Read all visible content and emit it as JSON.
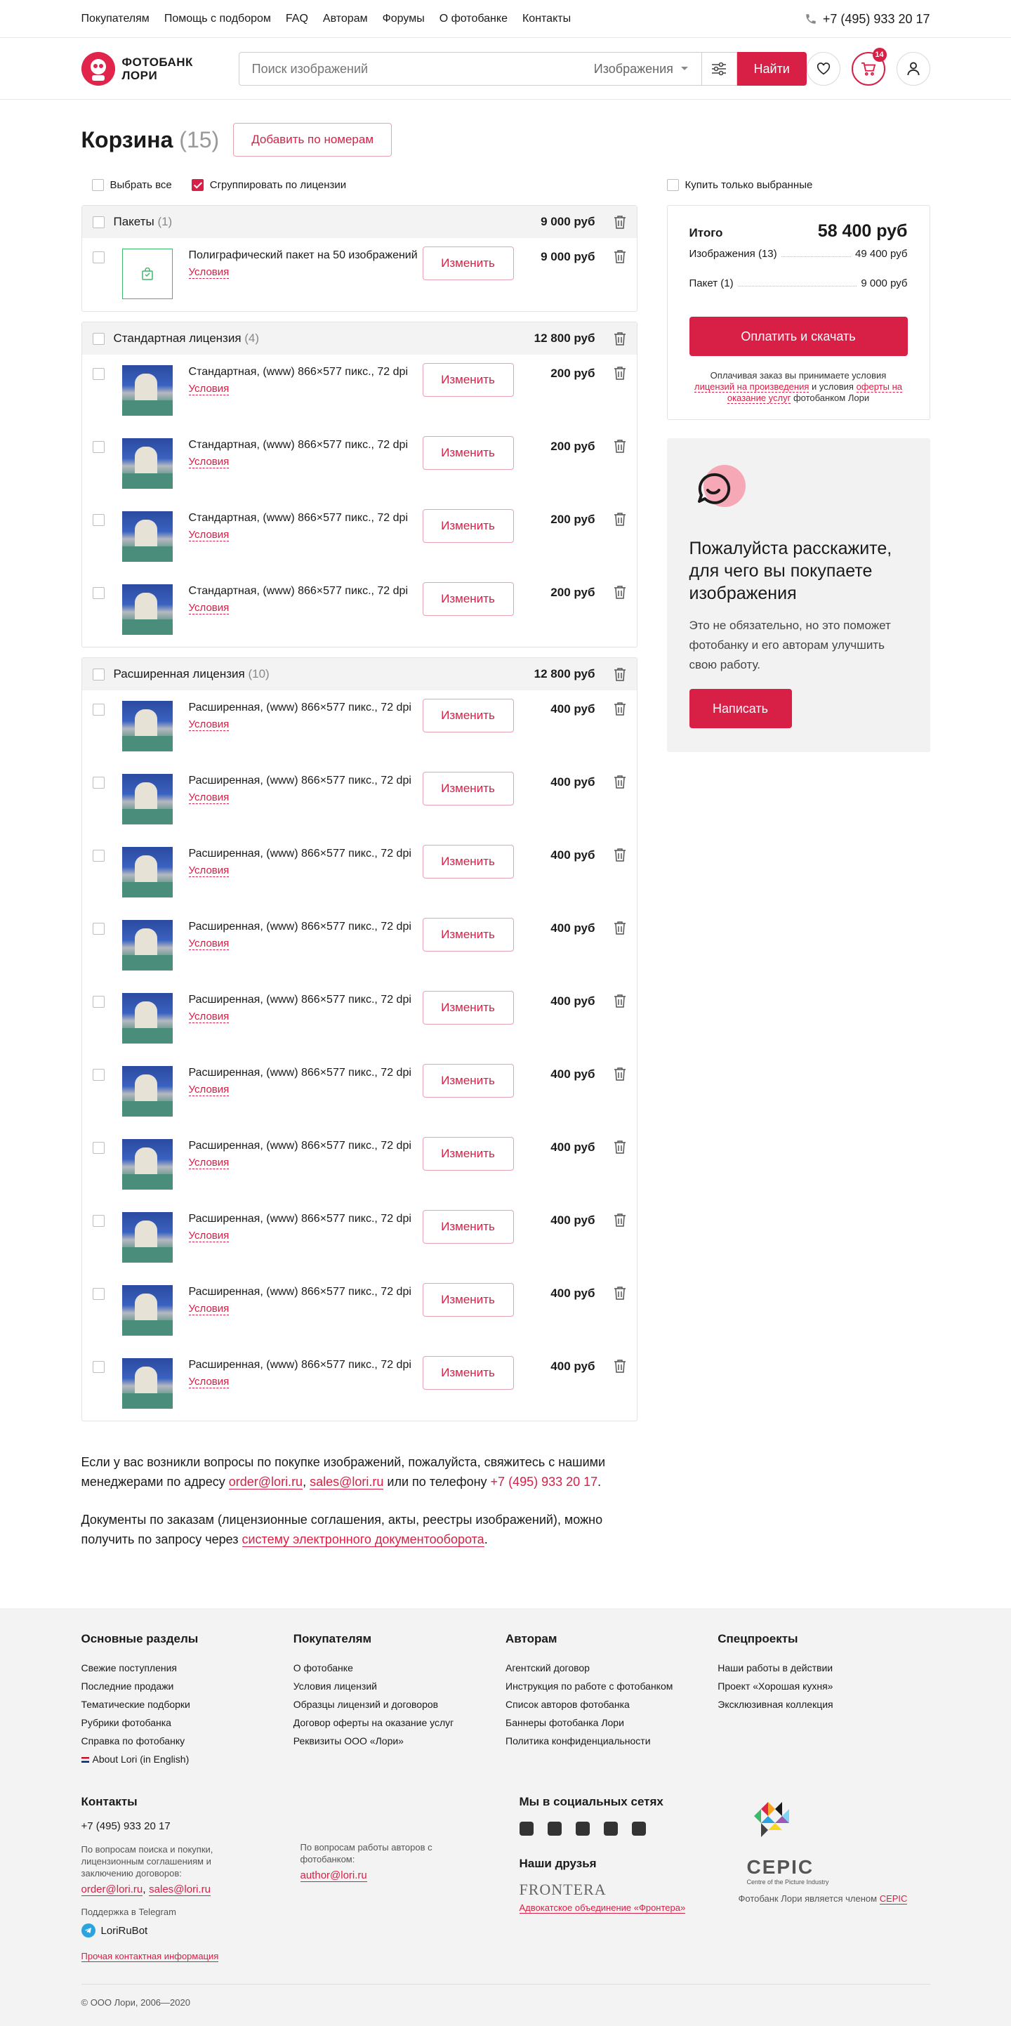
{
  "topbar": {
    "nav": [
      "Покупателям",
      "Помощь с подбором",
      "FAQ",
      "Авторам",
      "Форумы",
      "О фотобанке",
      "Контакты"
    ],
    "phone": "+7 (495) 933 20 17"
  },
  "header": {
    "logo_line1": "ФОТОБАНК",
    "logo_line2": "ЛОРИ",
    "search_placeholder": "Поиск изображений",
    "search_type": "Изображения",
    "find_label": "Найти",
    "cart_count": "14"
  },
  "page": {
    "title": "Корзина",
    "title_count": "(15)",
    "add_by_numbers": "Добавить по номерам",
    "select_all": "Выбрать все",
    "group_by_license": "Сгруппировать по лицензии",
    "buy_selected_only": "Купить только выбранные"
  },
  "groups": [
    {
      "name": "Пакеты",
      "count": "(1)",
      "sum": "9 000 руб",
      "items": [
        {
          "title": "Полиграфический пакет на 50 изображений",
          "terms": "Условия",
          "change": "Изменить",
          "price": "9 000 руб",
          "kind": "package"
        }
      ]
    },
    {
      "name": "Стандартная лицензия",
      "count": "(4)",
      "sum": "12 800 руб",
      "items": [
        {
          "title": "Стандартная, (www) 866×577 пикс., 72 dpi",
          "terms": "Условия",
          "change": "Изменить",
          "price": "200 руб"
        },
        {
          "title": "Стандартная, (www) 866×577 пикс., 72 dpi",
          "terms": "Условия",
          "change": "Изменить",
          "price": "200 руб"
        },
        {
          "title": "Стандартная, (www) 866×577 пикс., 72 dpi",
          "terms": "Условия",
          "change": "Изменить",
          "price": "200 руб"
        },
        {
          "title": "Стандартная, (www) 866×577 пикс., 72 dpi",
          "terms": "Условия",
          "change": "Изменить",
          "price": "200 руб"
        }
      ]
    },
    {
      "name": "Расширенная лицензия",
      "count": "(10)",
      "sum": "12 800 руб",
      "items": [
        {
          "title": "Расширенная, (www) 866×577 пикс., 72 dpi",
          "terms": "Условия",
          "change": "Изменить",
          "price": "400 руб"
        },
        {
          "title": "Расширенная, (www) 866×577 пикс., 72 dpi",
          "terms": "Условия",
          "change": "Изменить",
          "price": "400 руб"
        },
        {
          "title": "Расширенная, (www) 866×577 пикс., 72 dpi",
          "terms": "Условия",
          "change": "Изменить",
          "price": "400 руб"
        },
        {
          "title": "Расширенная, (www) 866×577 пикс., 72 dpi",
          "terms": "Условия",
          "change": "Изменить",
          "price": "400 руб"
        },
        {
          "title": "Расширенная, (www) 866×577 пикс., 72 dpi",
          "terms": "Условия",
          "change": "Изменить",
          "price": "400 руб"
        },
        {
          "title": "Расширенная, (www) 866×577 пикс., 72 dpi",
          "terms": "Условия",
          "change": "Изменить",
          "price": "400 руб"
        },
        {
          "title": "Расширенная, (www) 866×577 пикс., 72 dpi",
          "terms": "Условия",
          "change": "Изменить",
          "price": "400 руб"
        },
        {
          "title": "Расширенная, (www) 866×577 пикс., 72 dpi",
          "terms": "Условия",
          "change": "Изменить",
          "price": "400 руб"
        },
        {
          "title": "Расширенная, (www) 866×577 пикс., 72 dpi",
          "terms": "Условия",
          "change": "Изменить",
          "price": "400 руб"
        },
        {
          "title": "Расширенная, (www) 866×577 пикс., 72 dpi",
          "terms": "Условия",
          "change": "Изменить",
          "price": "400 руб"
        }
      ]
    }
  ],
  "summary": {
    "total_label": "Итого",
    "total_value": "58 400 руб",
    "images_label": "Изображения (13)",
    "images_value": "49 400 руб",
    "package_label": "Пакет (1)",
    "package_value": "9 000 руб",
    "pay_label": "Оплатить и скачать",
    "legal_1": "Оплачивая заказ вы принимаете условия",
    "legal_link1": "лицензий на произведения",
    "legal_2": "и условия",
    "legal_link2": "оферты на оказание услуг",
    "legal_3": "фотобанком Лори"
  },
  "promo": {
    "title": "Пожалуйста расскажите, для чего вы покупаете изображения",
    "text": "Это не обязательно, но это поможет фотобанку и его авторам улучшить свою работу.",
    "button": "Написать"
  },
  "note": {
    "p1_a": "Если у вас возникли вопросы по покупке изображений, пожалуйста, свяжитесь с нашими менеджерами по адресу",
    "p1_email1": "order@lori.ru",
    "p1_email2": "sales@lori.ru",
    "p1_b": "или по телефону",
    "p1_phone": "+7 (495) 933 20 17",
    "p2_a": "Документы по заказам (лицензионные соглашения, акты, реестры изображений), можно получить по запросу через",
    "p2_link": "систему электронного документооборота"
  },
  "footer": {
    "cols": [
      {
        "title": "Основные разделы",
        "links": [
          "Свежие поступления",
          "Последние продажи",
          "Тематические подборки",
          "Рубрики фотобанка",
          "Справка по фотобанку",
          "About Lori (in English)"
        ]
      },
      {
        "title": "Покупателям",
        "links": [
          "О фотобанке",
          "Условия лицензий",
          "Образцы лицензий и договоров",
          "Договор оферты на оказание услуг",
          "Реквизиты ООО «Лори»"
        ]
      },
      {
        "title": "Авторам",
        "links": [
          "Агентский договор",
          "Инструкция по работе с фотобанком",
          "Список авторов фотобанка",
          "Баннеры фотобанка Лори",
          "Политика конфиденциальности"
        ]
      },
      {
        "title": "Спецпроекты",
        "links": [
          "Наши работы в действии",
          "Проект «Хорошая кухня»",
          "Эксклюзивная коллекция"
        ]
      }
    ],
    "contacts_title": "Контакты",
    "contacts_phone": "+7 (495) 933 20 17",
    "buyers_note": "По вопросам поиска и покупки, лицензионным соглашениям и заключению договоров:",
    "buyers_email1": "order@lori.ru",
    "buyers_email2": "sales@lori.ru",
    "telegram_label": "Поддержка в Telegram",
    "telegram_bot": "LoriRuBot",
    "other_contacts": "Прочая контактная информация",
    "authors_note": "По вопросам работы авторов с фотобанком:",
    "authors_email": "author@lori.ru",
    "social_title": "Мы в социальных сетях",
    "friends_title": "Наши друзья",
    "friends_logo": "FRONTERA",
    "friends_link": "Адвокатское объединение «Фронтера»",
    "cepic_name": "CEPIC",
    "cepic_sub": "Centre of the Picture Industry",
    "cepic_member": "Фотобанк Лори является членом",
    "cepic_link": "CEPIC",
    "copyright": "© ООО Лори, 2006—2020"
  }
}
